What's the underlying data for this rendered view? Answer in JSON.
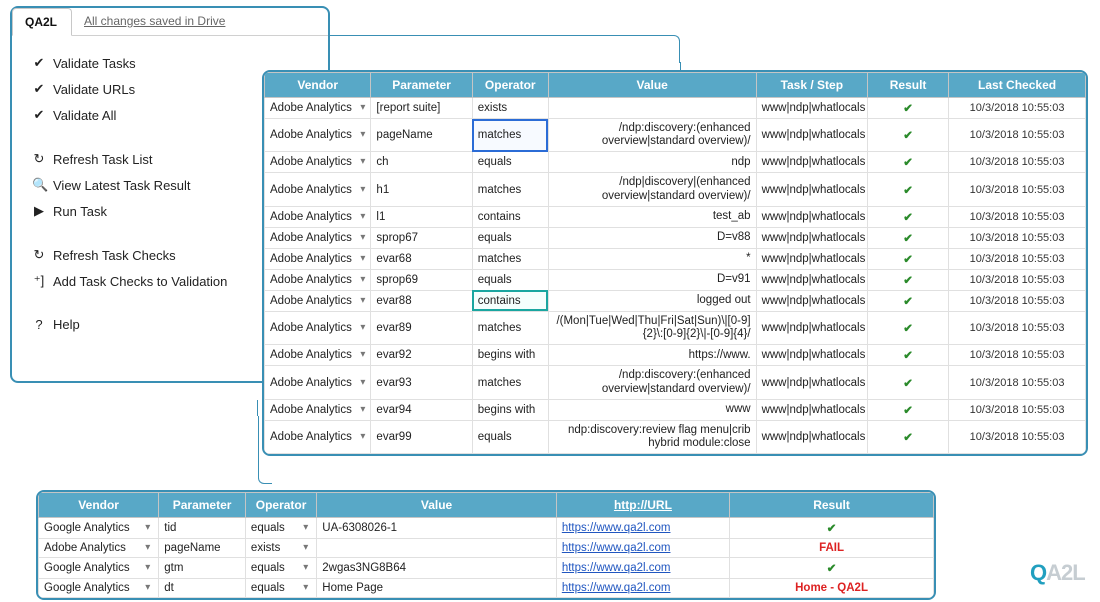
{
  "menu": {
    "app_title": "QA2L",
    "saved_label": "All changes saved in Drive",
    "groups": [
      {
        "items": [
          {
            "icon": "✔",
            "label": "Validate Tasks",
            "name": "menu-validate-tasks"
          },
          {
            "icon": "✔",
            "label": "Validate URLs",
            "name": "menu-validate-urls"
          },
          {
            "icon": "✔",
            "label": "Validate All",
            "name": "menu-validate-all"
          }
        ]
      },
      {
        "items": [
          {
            "icon": "↻",
            "label": "Refresh Task List",
            "name": "menu-refresh-task-list"
          },
          {
            "icon": "🔍",
            "label": "View Latest Task Result",
            "name": "menu-view-latest"
          },
          {
            "icon": "▶",
            "label": "Run Task",
            "name": "menu-run-task"
          }
        ]
      },
      {
        "items": [
          {
            "icon": "↻",
            "label": "Refresh Task Checks",
            "name": "menu-refresh-checks"
          },
          {
            "icon": "⁺]",
            "label": "Add Task Checks to Validation",
            "name": "menu-add-checks"
          }
        ]
      },
      {
        "items": [
          {
            "icon": "?",
            "label": "Help",
            "name": "menu-help"
          }
        ]
      }
    ]
  },
  "top_table": {
    "headers": [
      "Vendor",
      "Parameter",
      "Operator",
      "Value",
      "Task / Step",
      "Result",
      "Last Checked"
    ],
    "rows": [
      {
        "vendor": "Adobe Analytics",
        "parameter": "[report suite]",
        "operator": "exists",
        "value": "",
        "task": "www|ndp|whatlocals",
        "result": "✔",
        "checked": "10/3/2018 10:55:03",
        "sel": ""
      },
      {
        "vendor": "Adobe Analytics",
        "parameter": "pageName",
        "operator": "matches",
        "value": "/ndp:discovery:(enhanced overview|standard overview)/",
        "task": "www|ndp|whatlocals",
        "result": "✔",
        "checked": "10/3/2018 10:55:03",
        "sel": "blue"
      },
      {
        "vendor": "Adobe Analytics",
        "parameter": "ch",
        "operator": "equals",
        "value": "ndp",
        "task": "www|ndp|whatlocals",
        "result": "✔",
        "checked": "10/3/2018 10:55:03",
        "sel": ""
      },
      {
        "vendor": "Adobe Analytics",
        "parameter": "h1",
        "operator": "matches",
        "value": "/ndp|discovery|(enhanced overview|standard overview)/",
        "task": "www|ndp|whatlocals",
        "result": "✔",
        "checked": "10/3/2018 10:55:03",
        "sel": ""
      },
      {
        "vendor": "Adobe Analytics",
        "parameter": "l1",
        "operator": "contains",
        "value": "test_ab",
        "task": "www|ndp|whatlocals",
        "result": "✔",
        "checked": "10/3/2018 10:55:03",
        "sel": ""
      },
      {
        "vendor": "Adobe Analytics",
        "parameter": "sprop67",
        "operator": "equals",
        "value": "D=v88",
        "task": "www|ndp|whatlocals",
        "result": "✔",
        "checked": "10/3/2018 10:55:03",
        "sel": ""
      },
      {
        "vendor": "Adobe Analytics",
        "parameter": "evar68",
        "operator": "matches",
        "value": "*",
        "task": "www|ndp|whatlocals",
        "result": "✔",
        "checked": "10/3/2018 10:55:03",
        "sel": ""
      },
      {
        "vendor": "Adobe Analytics",
        "parameter": "sprop69",
        "operator": "equals",
        "value": "D=v91",
        "task": "www|ndp|whatlocals",
        "result": "✔",
        "checked": "10/3/2018 10:55:03",
        "sel": ""
      },
      {
        "vendor": "Adobe Analytics",
        "parameter": "evar88",
        "operator": "contains",
        "value": "logged out",
        "task": "www|ndp|whatlocals",
        "result": "✔",
        "checked": "10/3/2018 10:55:03",
        "sel": "teal"
      },
      {
        "vendor": "Adobe Analytics",
        "parameter": "evar89",
        "operator": "matches",
        "value": "/(Mon|Tue|Wed|Thu|Fri|Sat|Sun)\\|[0-9]{2}\\:[0-9]{2}\\|-[0-9]{4}/",
        "task": "www|ndp|whatlocals",
        "result": "✔",
        "checked": "10/3/2018 10:55:03",
        "sel": ""
      },
      {
        "vendor": "Adobe Analytics",
        "parameter": "evar92",
        "operator": "begins with",
        "value": "https://www.",
        "task": "www|ndp|whatlocals",
        "result": "✔",
        "checked": "10/3/2018 10:55:03",
        "sel": ""
      },
      {
        "vendor": "Adobe Analytics",
        "parameter": "evar93",
        "operator": "matches",
        "value": "/ndp:discovery:(enhanced overview|standard overview)/",
        "task": "www|ndp|whatlocals",
        "result": "✔",
        "checked": "10/3/2018 10:55:03",
        "sel": ""
      },
      {
        "vendor": "Adobe Analytics",
        "parameter": "evar94",
        "operator": "begins with",
        "value": "www",
        "task": "www|ndp|whatlocals",
        "result": "✔",
        "checked": "10/3/2018 10:55:03",
        "sel": ""
      },
      {
        "vendor": "Adobe Analytics",
        "parameter": "evar99",
        "operator": "equals",
        "value": "ndp:discovery:review flag menu|crib hybrid module:close",
        "task": "www|ndp|whatlocals",
        "result": "✔",
        "checked": "10/3/2018 10:55:03",
        "sel": ""
      }
    ]
  },
  "bottom_table": {
    "headers": [
      "Vendor",
      "Parameter",
      "Operator",
      "Value",
      "http://URL",
      "Result"
    ],
    "rows": [
      {
        "vendor": "Google Analytics",
        "parameter": "tid",
        "operator": "equals",
        "value": "UA-6308026-1",
        "url": "https://www.qa2l.com",
        "result": "✔",
        "result_class": "pass"
      },
      {
        "vendor": "Adobe Analytics",
        "parameter": "pageName",
        "operator": "exists",
        "value": "",
        "url": "https://www.qa2l.com",
        "result": "FAIL",
        "result_class": "fail"
      },
      {
        "vendor": "Google Analytics",
        "parameter": "gtm",
        "operator": "equals",
        "value": "2wgas3NG8B64",
        "url": "https://www.qa2l.com",
        "result": "✔",
        "result_class": "pass"
      },
      {
        "vendor": "Google Analytics",
        "parameter": "dt",
        "operator": "equals",
        "value": "Home Page",
        "url": "https://www.qa2l.com",
        "result": "Home - QA2L",
        "result_class": "fail"
      }
    ]
  },
  "logo": {
    "text_q": "Q",
    "text_rest": "A2L"
  }
}
